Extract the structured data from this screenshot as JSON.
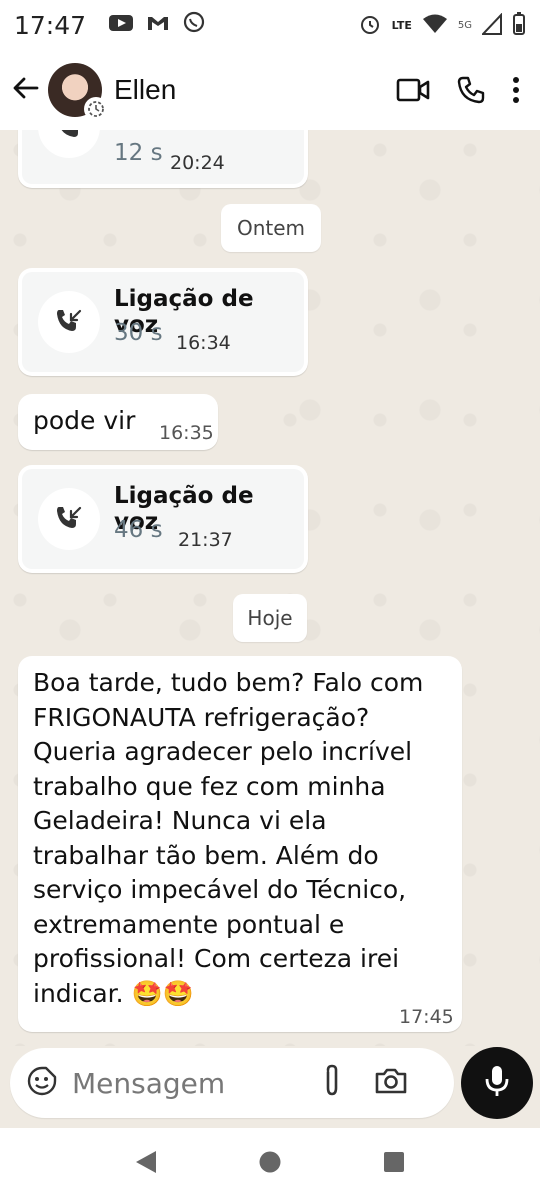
{
  "status_bar": {
    "time": "17:47",
    "network_label": "LTE",
    "signal_label": "5G"
  },
  "header": {
    "contact_name": "Ellen",
    "icons": [
      "back-arrow-icon",
      "avatar",
      "video-call-icon",
      "phone-call-icon",
      "more-options-icon"
    ]
  },
  "messages": [
    {
      "type": "call",
      "duration": "12 s",
      "time": "20:24",
      "partial": true
    },
    {
      "type": "date",
      "label": "Ontem"
    },
    {
      "type": "call",
      "title": "Ligação de voz",
      "duration": "30 s",
      "time": "16:34"
    },
    {
      "type": "text",
      "text": "pode vir",
      "time": "16:35"
    },
    {
      "type": "call",
      "title": "Ligação de voz",
      "duration": "46 s",
      "time": "21:37"
    },
    {
      "type": "date",
      "label": "Hoje"
    },
    {
      "type": "text",
      "lines": [
        "Boa tarde, tudo bem? Falo com",
        "FRIGONAUTA refrigeração?",
        "Queria agradecer pelo incrível",
        "trabalho que fez com minha",
        "Geladeira! Nunca vi ela",
        "trabalhar tão bem. Além do",
        "serviço impecável do Técnico,",
        "extremamente pontual e",
        "profissional! Com certeza irei",
        "indicar. 🤩🤩"
      ],
      "time": "17:45"
    }
  ],
  "composer": {
    "placeholder": "Mensagem"
  },
  "colors": {
    "chat_background": "#efeae2",
    "bubble": "#ffffff",
    "call_card": "#f5f6f6",
    "mic_button": "#111111"
  }
}
